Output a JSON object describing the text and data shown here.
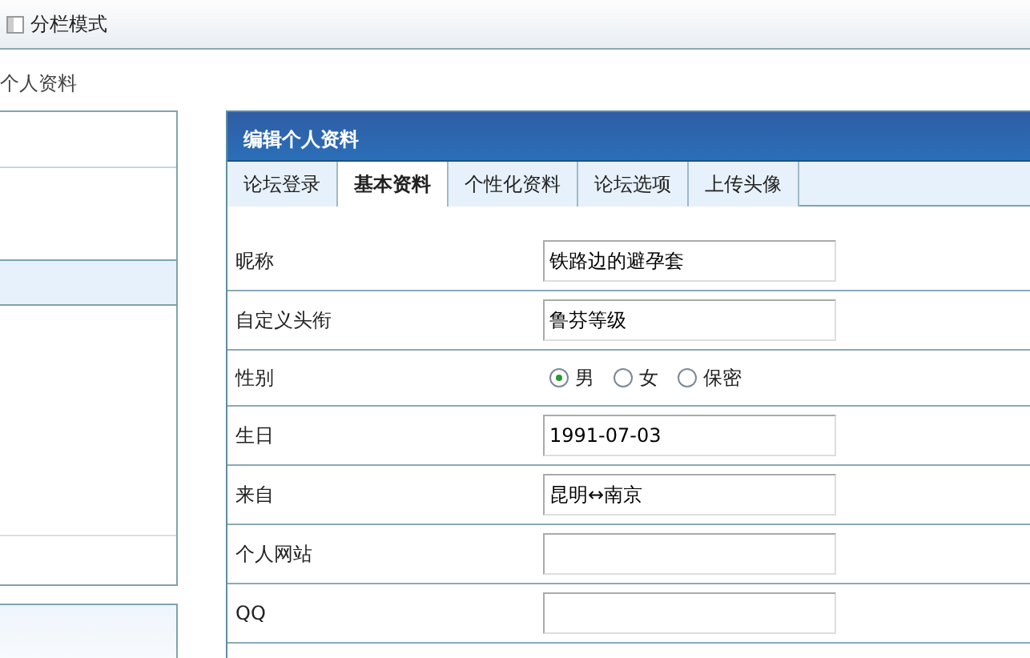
{
  "toolbar": {
    "label": "分栏模式"
  },
  "breadcrumb": "个人资料",
  "panel": {
    "title": "编辑个人资料"
  },
  "tabs": [
    {
      "label": "论坛登录",
      "selected": false
    },
    {
      "label": "基本资料",
      "selected": true
    },
    {
      "label": "个性化资料",
      "selected": false
    },
    {
      "label": "论坛选项",
      "selected": false
    },
    {
      "label": "上传头像",
      "selected": false
    }
  ],
  "fields": [
    {
      "kind": "text",
      "label": "昵称",
      "value": "铁路边的避孕套"
    },
    {
      "kind": "text",
      "label": "自定义头衔",
      "value": "鲁芬等级"
    },
    {
      "kind": "radio",
      "label": "性别",
      "options": [
        {
          "label": "男",
          "selected": true
        },
        {
          "label": "女",
          "selected": false
        },
        {
          "label": "保密",
          "selected": false
        }
      ]
    },
    {
      "kind": "text",
      "label": "生日",
      "value": "1991-07-03"
    },
    {
      "kind": "text",
      "label": "来自",
      "value": "昆明↔南京"
    },
    {
      "kind": "text",
      "label": "个人网站"
    },
    {
      "kind": "text",
      "label": "QQ"
    }
  ]
}
